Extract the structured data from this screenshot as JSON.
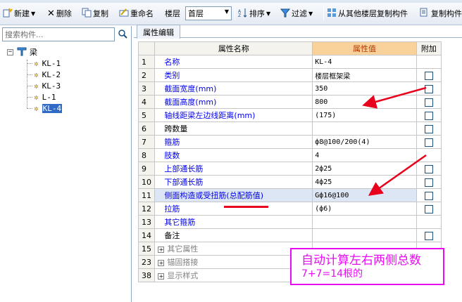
{
  "toolbar": {
    "new_label": "新建",
    "delete_label": "删除",
    "copy_label": "复制",
    "rename_label": "重命名",
    "floor_label": "楼层",
    "floor_value": "首层",
    "sort_label": "排序",
    "filter_label": "过滤",
    "copy_from_floor_label": "从其他楼层复制构件",
    "copy_component_label": "复制构件"
  },
  "left": {
    "search_placeholder": "搜索构件...",
    "tree_root": "梁",
    "tree_items": [
      "KL-1",
      "KL-2",
      "KL-3",
      "L-1",
      "KL-4"
    ],
    "selected": "KL-4"
  },
  "right": {
    "tab": "属性编辑",
    "headers": [
      "属性名称",
      "属性值",
      "附加"
    ],
    "rows": [
      {
        "num": "1",
        "name": "名称",
        "value": "KL-4",
        "check": false
      },
      {
        "num": "2",
        "name": "类别",
        "value": "楼层框架梁",
        "check": true
      },
      {
        "num": "3",
        "name": "截面宽度(mm)",
        "value": "350",
        "check": true
      },
      {
        "num": "4",
        "name": "截面高度(mm)",
        "value": "800",
        "check": true
      },
      {
        "num": "5",
        "name": "轴线距梁左边线距离(mm)",
        "value": "(175)",
        "check": true
      },
      {
        "num": "6",
        "name": "跨数量",
        "value": "",
        "check": true
      },
      {
        "num": "7",
        "name": "箍筋",
        "value": "ф8@100/200(4)",
        "check": true
      },
      {
        "num": "8",
        "name": "肢数",
        "value": "4",
        "check": false
      },
      {
        "num": "9",
        "name": "上部通长筋",
        "value": "2ф25",
        "check": true
      },
      {
        "num": "10",
        "name": "下部通长筋",
        "value": "4ф25",
        "check": true
      },
      {
        "num": "11",
        "name": "侧面构造或受扭筋(总配筋值)",
        "value": "Gф16@100",
        "check": true
      },
      {
        "num": "12",
        "name": "拉筋",
        "value": "(ф6)",
        "check": true
      },
      {
        "num": "13",
        "name": "其它箍筋",
        "value": "",
        "check": false
      },
      {
        "num": "14",
        "name": "备注",
        "value": "",
        "check": true
      }
    ],
    "groups": [
      {
        "num": "15",
        "name": "其它属性"
      },
      {
        "num": "23",
        "name": "锚固搭接"
      },
      {
        "num": "38",
        "name": "显示样式"
      }
    ]
  },
  "annotation": {
    "line1": "自动计算左右两侧总数",
    "line2": "7+7=14根的"
  },
  "colors": {
    "value_header_bg": "#f8d29a",
    "annotation": "#e60ef0",
    "arrow": "#e8001c",
    "selection": "#316ac5"
  }
}
